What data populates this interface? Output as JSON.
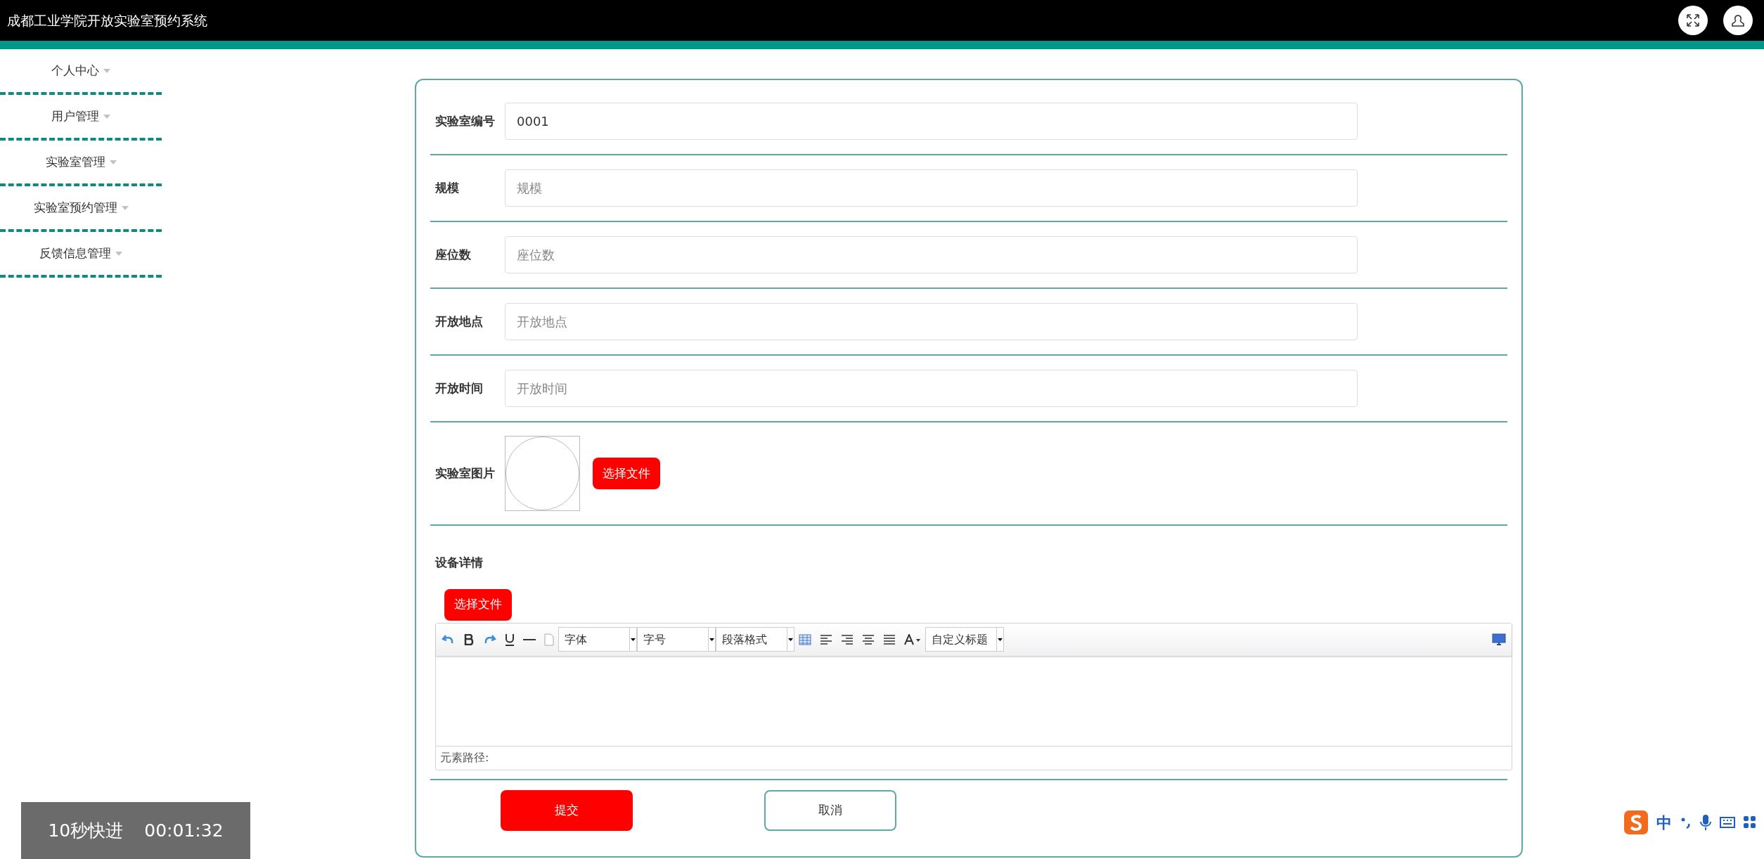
{
  "header": {
    "title": "成都工业学院开放实验室预约系统"
  },
  "sidebar": {
    "items": [
      {
        "label": "个人中心",
        "selected": false
      },
      {
        "label": "用户管理",
        "selected": false
      },
      {
        "label": "实验室管理",
        "selected": false
      },
      {
        "label": "实验室预约管理",
        "selected": false
      },
      {
        "label": "反馈信息管理",
        "selected": false
      }
    ]
  },
  "form": {
    "fields": [
      {
        "label": "实验室编号",
        "value": "0001"
      },
      {
        "label": "规模",
        "placeholder": "规模"
      },
      {
        "label": "座位数",
        "placeholder": "座位数"
      },
      {
        "label": "开放地点",
        "placeholder": "开放地点"
      },
      {
        "label": "开放时间",
        "placeholder": "开放时间"
      }
    ],
    "picture": {
      "label": "实验室图片",
      "button": "选择文件"
    },
    "details": {
      "label": "设备详情",
      "button": "选择文件",
      "editor": {
        "selects": [
          "字体",
          "字号",
          "段落格式",
          "自定义标题"
        ],
        "path_label": "元素路径:"
      }
    },
    "buttons": [
      {
        "label": "提交",
        "kind": "primary"
      },
      {
        "label": "取消",
        "kind": "secondary"
      }
    ]
  },
  "video_overlay": {
    "skip": "10秒快进",
    "time": "00:01:32"
  },
  "ime_bar": {
    "mode": "中"
  }
}
